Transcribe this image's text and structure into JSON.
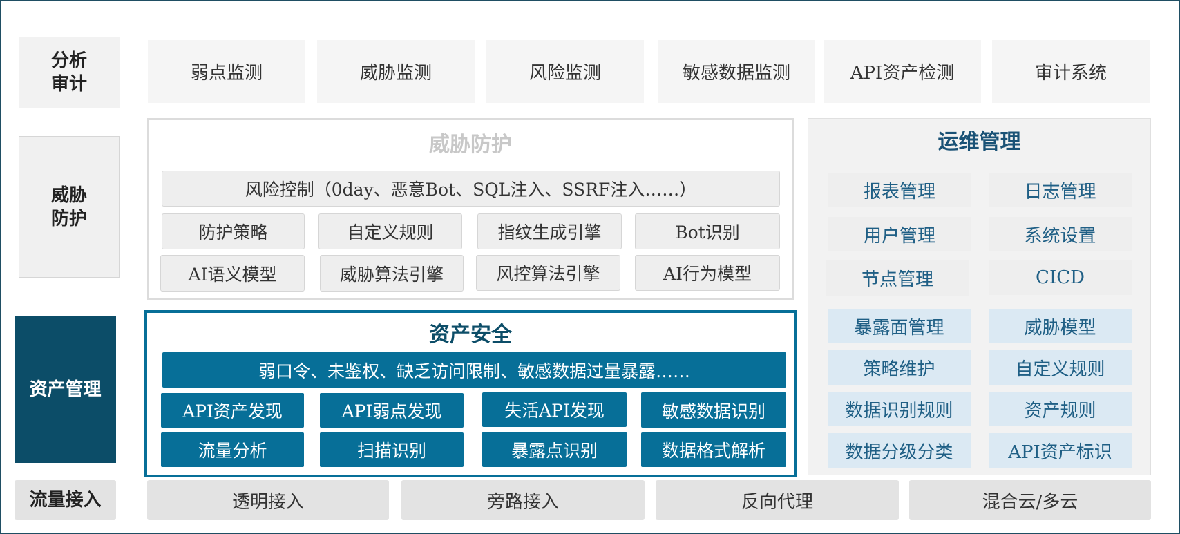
{
  "rows": {
    "analysis": {
      "label_lines": [
        "分析",
        "审计"
      ]
    },
    "threat": {
      "label_lines": [
        "威胁",
        "防护"
      ]
    },
    "asset": {
      "label_lines": [
        "资产管理"
      ]
    },
    "flow": {
      "label_lines": [
        "流量接入"
      ]
    }
  },
  "analysis_items": [
    "弱点监测",
    "威胁监测",
    "风险监测",
    "敏感数据监测",
    "API资产检测",
    "审计系统"
  ],
  "threat_panel": {
    "title": "威胁防护",
    "banner": "风险控制（0day、恶意Bot、SQL注入、SSRF注入……）",
    "items": [
      "防护策略",
      "自定义规则",
      "指纹生成引擎",
      "Bot识别",
      "AI语义模型",
      "威胁算法引擎",
      "风控算法引擎",
      "AI行为模型"
    ]
  },
  "asset_panel": {
    "title": "资产安全",
    "banner": "弱口令、未鉴权、缺乏访问限制、敏感数据过量暴露……",
    "items": [
      "API资产发现",
      "API弱点发现",
      "失活API发现",
      "敏感数据识别",
      "流量分析",
      "扫描识别",
      "暴露点识别",
      "数据格式解析"
    ]
  },
  "ops_panel": {
    "title": "运维管理",
    "items": [
      "报表管理",
      "日志管理",
      "用户管理",
      "系统设置",
      "节点管理",
      "CICD",
      "暴露面管理",
      "威胁模型",
      "策略维护",
      "自定义规则",
      "数据识别规则",
      "资产规则",
      "数据分级分类",
      "API资产标识"
    ]
  },
  "flow_items": [
    "透明接入",
    "旁路接入",
    "反向代理",
    "混合云/多云"
  ],
  "colors": {
    "asset_dark": "#0c4d68",
    "asset_blue": "#076f98",
    "ops_text": "#1f5f85",
    "ops_light_blue": "#dbe9f3",
    "gray_panel": "#f2f2f2",
    "threat_title": "#c8c8c8"
  }
}
